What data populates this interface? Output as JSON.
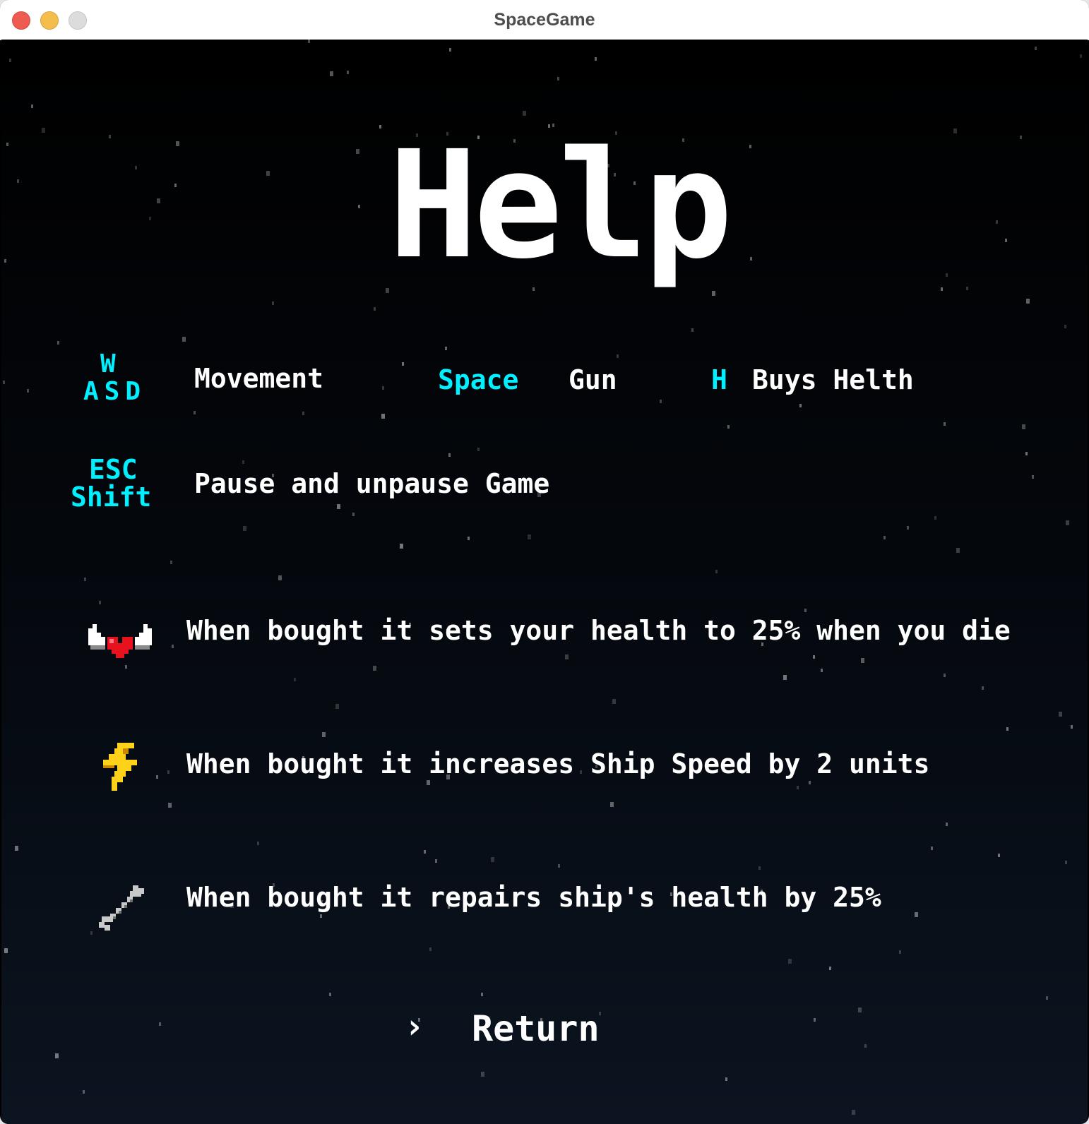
{
  "window": {
    "title": "SpaceGame"
  },
  "screen": {
    "title": "Help"
  },
  "controls": {
    "movement": {
      "key_top": "W",
      "key_bottom": "ASD",
      "label": "Movement"
    },
    "gun": {
      "key": "Space",
      "label": "Gun"
    },
    "health": {
      "key": "H",
      "label": "Buys Helth"
    },
    "pause": {
      "key_top": "ESC",
      "key_bottom": "Shift",
      "label": "Pause and unpause Game"
    }
  },
  "powerups": [
    {
      "icon": "winged-heart-icon",
      "description": "When bought it sets your health to 25% when you die"
    },
    {
      "icon": "lightning-bolt-icon",
      "description": "When bought it increases Ship Speed by 2 units"
    },
    {
      "icon": "wrench-icon",
      "description": "When bought it repairs ship's health by 25%"
    }
  ],
  "menu": {
    "selector": "›",
    "return_label": "Return"
  },
  "colors": {
    "key_highlight": "#00f0ff",
    "text": "#ffffff",
    "background": "#000000",
    "bolt": "#ffd21a",
    "heart": "#e8121e"
  }
}
